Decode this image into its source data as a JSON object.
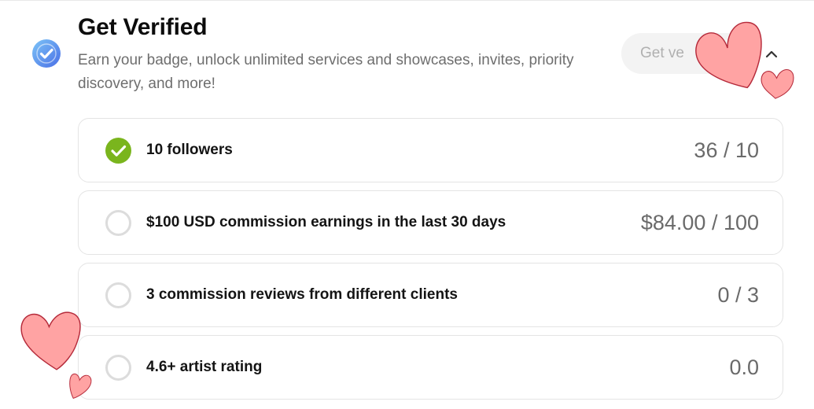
{
  "header": {
    "title": "Get Verified",
    "description": "Earn your badge, unlock unlimited services and showcases, invites, priority discovery, and more!",
    "get_verified_label": "Get ve",
    "badge_icon": "verified-check-badge-icon",
    "collapse_icon": "chevron-up-icon"
  },
  "requirements": [
    {
      "label": "10 followers",
      "progress": "36 / 10",
      "completed": true
    },
    {
      "label": "$100 USD commission earnings in the last 30 days",
      "progress": "$84.00 / 100",
      "completed": false
    },
    {
      "label": "3 commission reviews from different clients",
      "progress": "0 / 3",
      "completed": false
    },
    {
      "label": "4.6+ artist rating",
      "progress": "0.0",
      "completed": false
    }
  ],
  "colors": {
    "completed_green": "#7ab51d",
    "heart_fill": "#ffa3a3",
    "heart_stroke": "#b52a3a",
    "badge_blue": "#5b8ff0"
  }
}
